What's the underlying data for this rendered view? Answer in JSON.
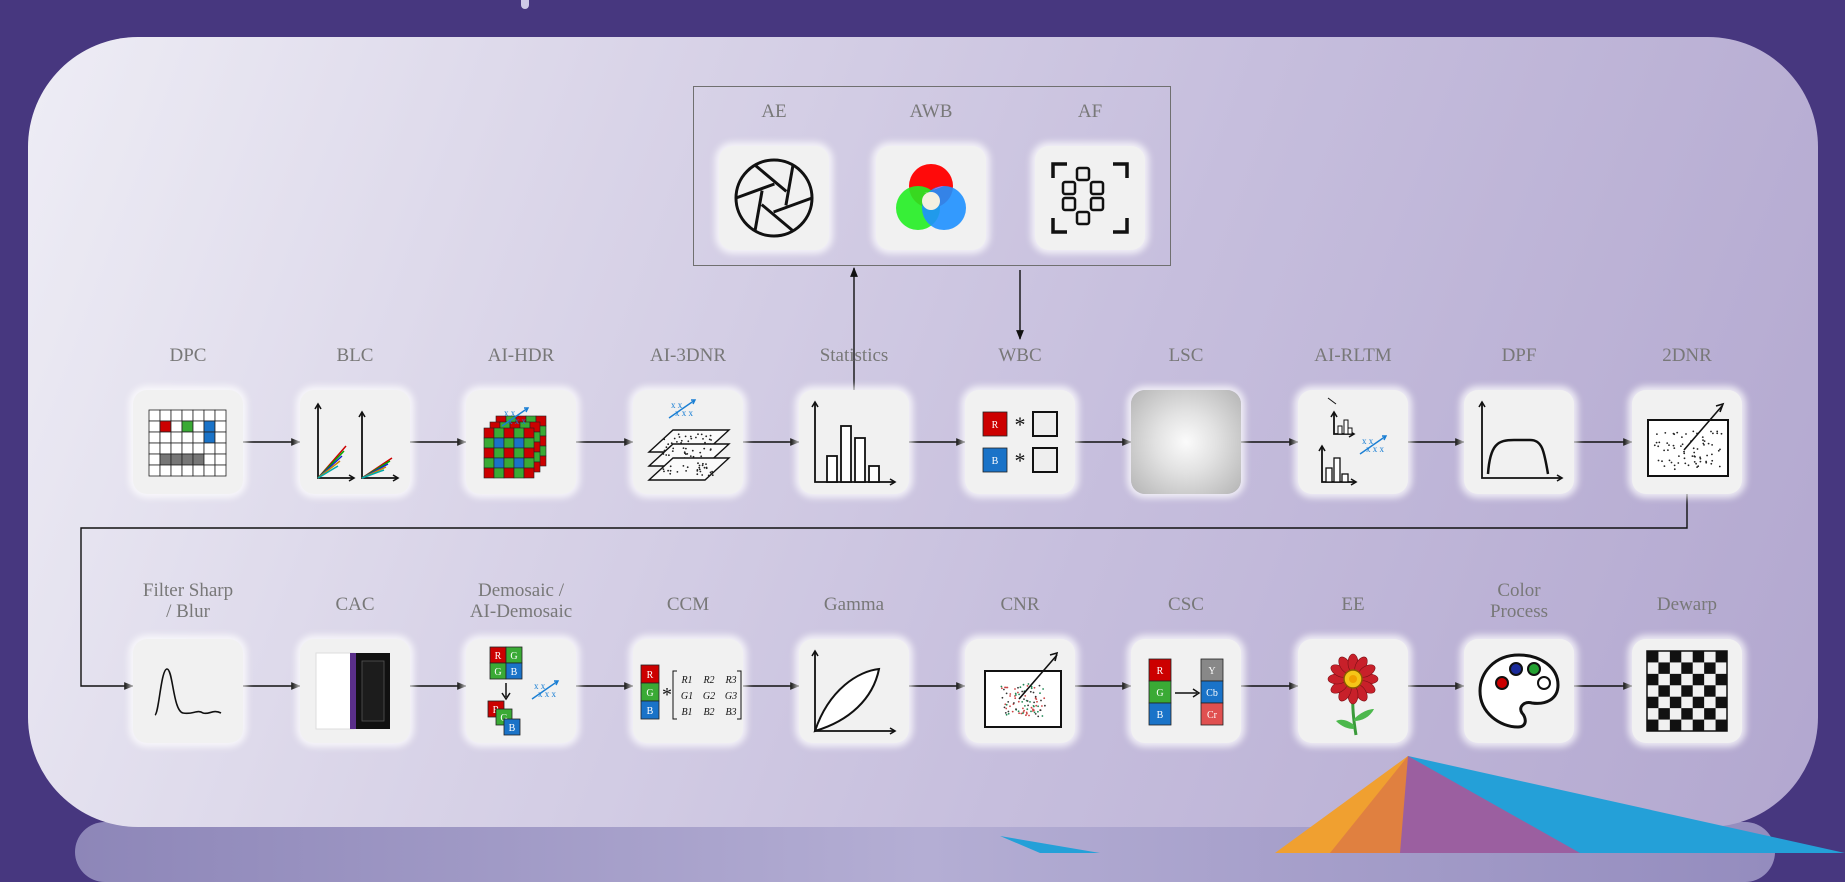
{
  "title": "",
  "top_group": {
    "stages": [
      {
        "label": "AE",
        "icon": "aperture-icon"
      },
      {
        "label": "AWB",
        "icon": "rgb-circles-icon"
      },
      {
        "label": "AF",
        "icon": "focus-frame-icon"
      }
    ]
  },
  "row1": [
    {
      "label": "DPC",
      "icon": "pixel-grid-icon"
    },
    {
      "label": "BLC",
      "icon": "vector-axes-icon"
    },
    {
      "label": "AI-HDR",
      "icon": "stacked-bayer-icon"
    },
    {
      "label": "AI-3DNR",
      "icon": "stacked-noise-layers-icon"
    },
    {
      "label": "Statistics",
      "icon": "histogram-icon"
    },
    {
      "label": "WBC",
      "icon": "rb-gain-icon"
    },
    {
      "label": "LSC",
      "icon": "vignette-icon"
    },
    {
      "label": "AI-RLTM",
      "icon": "tone-mapping-icon"
    },
    {
      "label": "DPF",
      "icon": "filter-curve-icon"
    },
    {
      "label": "2DNR",
      "icon": "noise-box-icon"
    }
  ],
  "row2": [
    {
      "label": "Filter Sharp\n/ Blur",
      "icon": "impulse-response-icon"
    },
    {
      "label": "CAC",
      "icon": "color-fringe-icon"
    },
    {
      "label": "Demosaic /\nAI-Demosaic",
      "icon": "demosaic-icon"
    },
    {
      "label": "CCM",
      "icon": "color-matrix-icon"
    },
    {
      "label": "Gamma",
      "icon": "gamma-curve-icon"
    },
    {
      "label": "CNR",
      "icon": "chroma-noise-icon"
    },
    {
      "label": "CSC",
      "icon": "rgb-to-ycbcr-icon"
    },
    {
      "label": "EE",
      "icon": "flower-icon"
    },
    {
      "label": "Color\nProcess",
      "icon": "palette-icon"
    },
    {
      "label": "Dewarp",
      "icon": "checkerboard-icon"
    }
  ],
  "colors": {
    "background": "#47377f",
    "panel": "#d7d1e7",
    "label": "#787878",
    "tile": "#f1f1f1",
    "red": "#cc0000",
    "green": "#3aaa35",
    "blue": "#1a73c8",
    "noise_blue": "#1a7fd4"
  }
}
